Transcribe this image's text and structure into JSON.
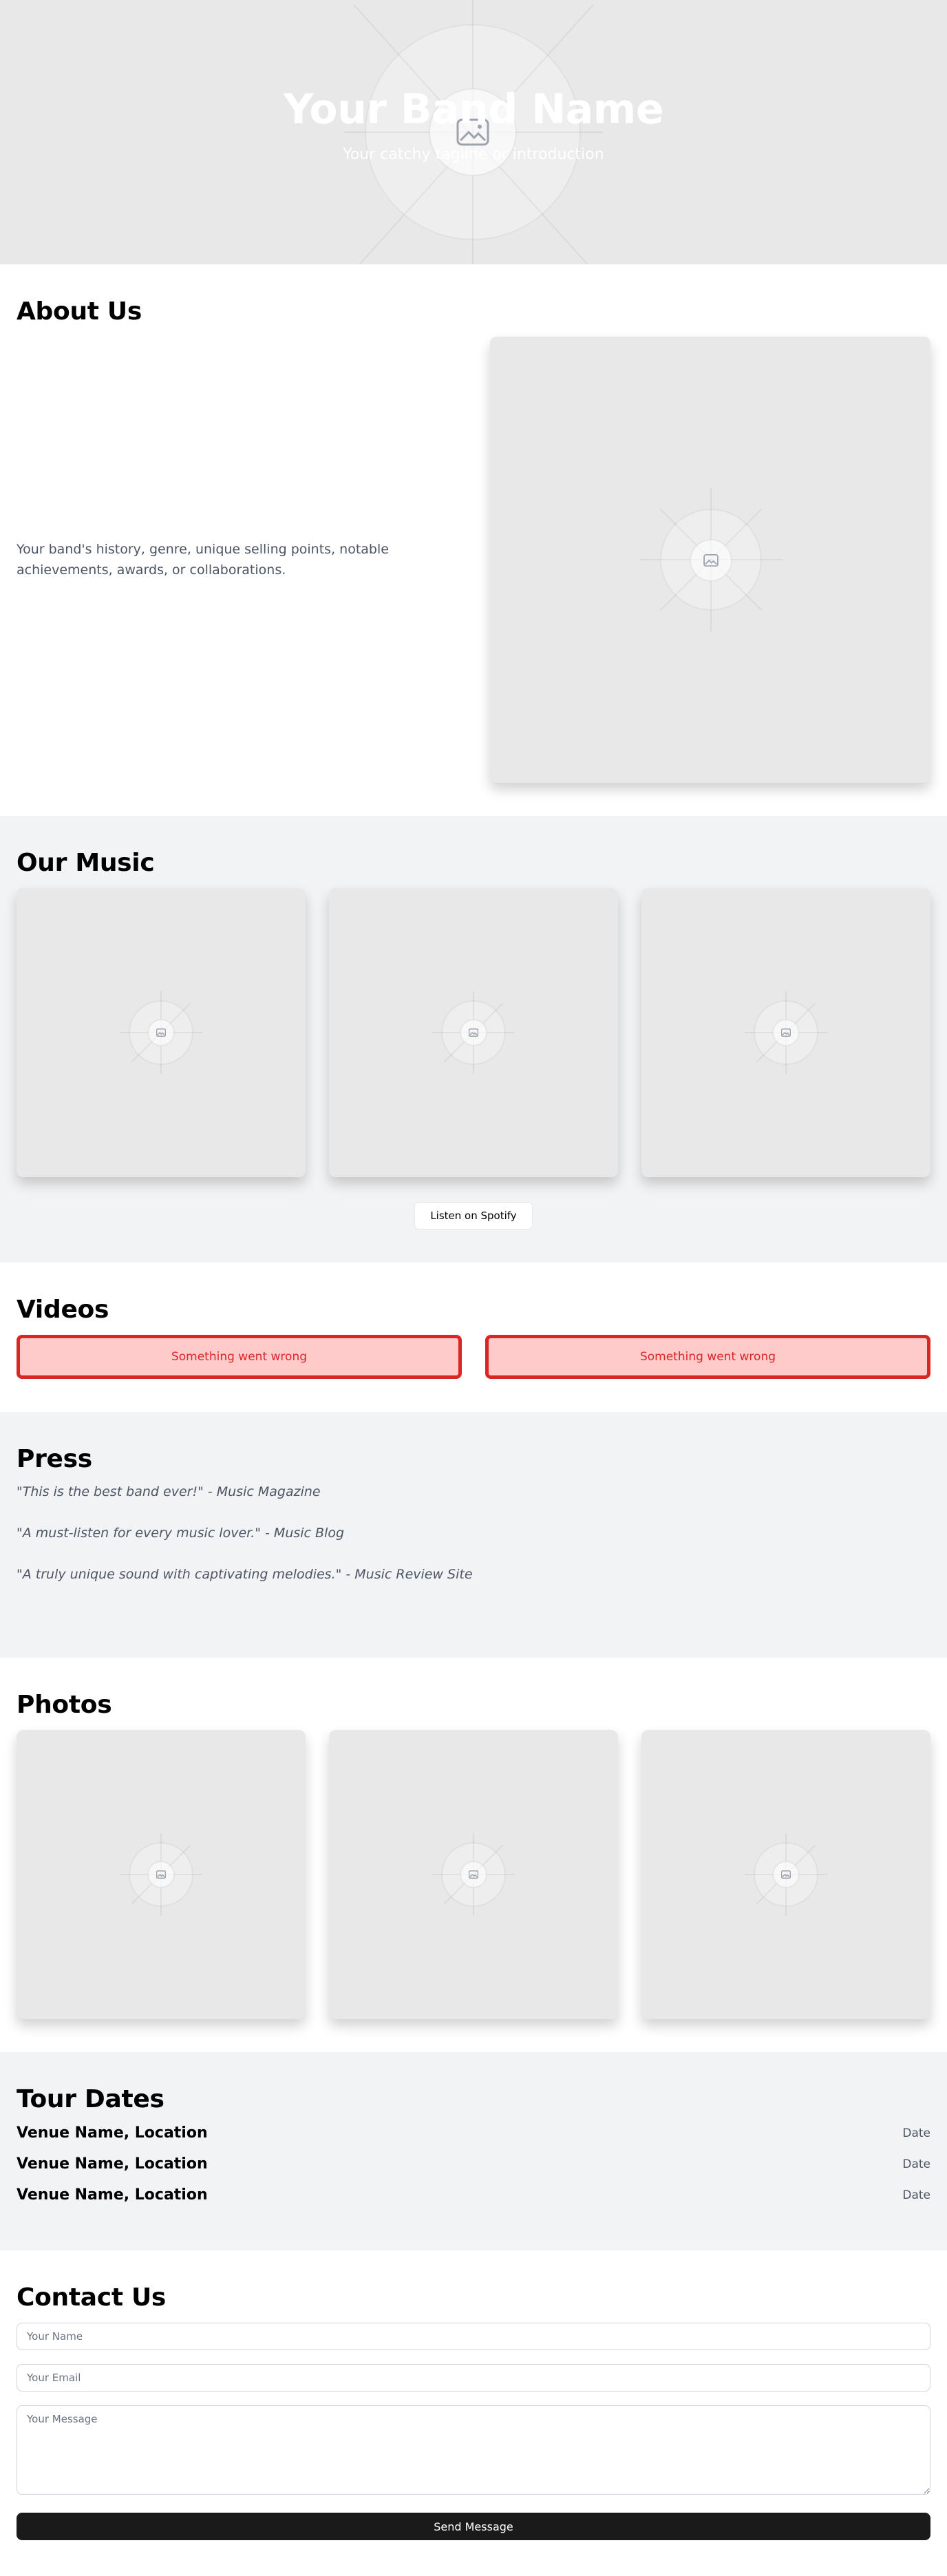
{
  "hero": {
    "title": "Your Band Name",
    "subtitle": "Your catchy tagline or introduction"
  },
  "about": {
    "heading": "About Us",
    "text": "Your band's history, genre, unique selling points, notable achievements, awards, or collaborations."
  },
  "music": {
    "heading": "Our Music",
    "spotify_label": "Listen on Spotify"
  },
  "videos": {
    "heading": "Videos",
    "items": [
      {
        "error": "Something went wrong"
      },
      {
        "error": "Something went wrong"
      }
    ]
  },
  "press": {
    "heading": "Press",
    "quotes": [
      "\"This is the best band ever!\" - Music Magazine",
      "\"A must-listen for every music lover.\" - Music Blog",
      "\"A truly unique sound with captivating melodies.\" - Music Review Site"
    ]
  },
  "photos": {
    "heading": "Photos"
  },
  "tour": {
    "heading": "Tour Dates",
    "items": [
      {
        "venue": "Venue Name, Location",
        "date": "Date"
      },
      {
        "venue": "Venue Name, Location",
        "date": "Date"
      },
      {
        "venue": "Venue Name, Location",
        "date": "Date"
      }
    ]
  },
  "contact": {
    "heading": "Contact Us",
    "name_placeholder": "Your Name",
    "email_placeholder": "Your Email",
    "message_placeholder": "Your Message",
    "submit_label": "Send Message"
  },
  "icons": {
    "placeholder": "image-placeholder-icon"
  },
  "colors": {
    "error_border": "#dc2626",
    "error_bg": "#fecaca",
    "dark_button": "#1a1a1a",
    "section_gray": "#f2f3f5"
  }
}
